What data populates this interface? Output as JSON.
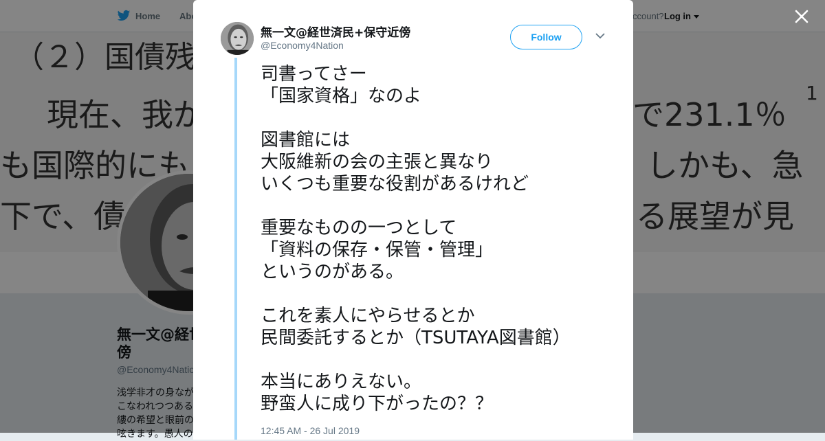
{
  "nav": {
    "home_label": "Home",
    "about_label": "Abo",
    "account_text": "ccount?",
    "login_label": "Log in"
  },
  "header_image": {
    "lines": [
      "（２）国債残",
      "現在、我が",
      "で231.1％",
      "1",
      "も国際的にも",
      "しかも、急",
      "下で、債",
      "る展望が見"
    ]
  },
  "profile": {
    "name_line1": "無一文@経世",
    "name_line2": "傍",
    "handle": "@Economy4Nation",
    "bio_lines": [
      "浅学非才の身なが",
      "こなわれつつある",
      "縷の希望と眼前の",
      "呟きます。愚人の"
    ]
  },
  "tweet": {
    "author_name": "無一文@経世済民+保守近傍",
    "author_handle": "@Economy4Nation",
    "follow_label": "Follow",
    "text_lines": [
      "司書ってさー",
      "「国家資格」なのよ",
      "",
      "図書館には",
      "大阪維新の会の主張と異なり",
      "いくつも重要な役割があるけれど",
      "",
      "重要なものの一つとして",
      "「資料の保存・保管・管理」",
      "というのがある。",
      "",
      "これを素人にやらせるとか",
      "民間委託するとか（TSUTAYA図書館）",
      "",
      "本当にありえない。",
      "野蛮人に成り下がったの？？"
    ],
    "timestamp": "12:45 AM - 26 Jul 2019"
  },
  "icons": {
    "bird": "twitter-bird-icon",
    "close": "close-icon",
    "chevron": "chevron-down-icon",
    "caret": "caret-down-icon"
  },
  "colors": {
    "accent": "#1da1f2",
    "thread_line": "#a6d8fa",
    "text": "#14171a",
    "secondary_text": "#657786"
  }
}
